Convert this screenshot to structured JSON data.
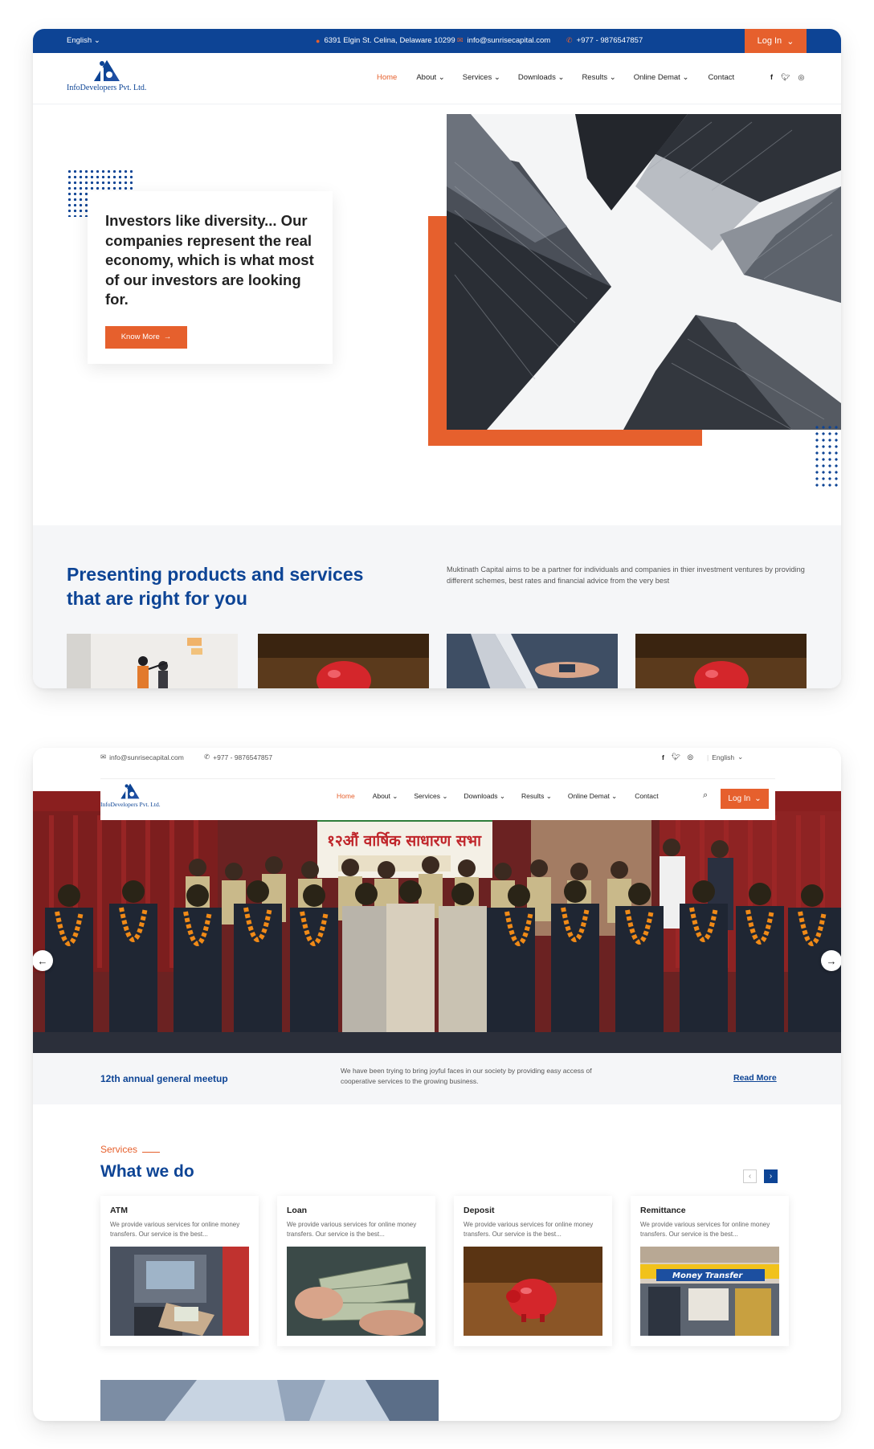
{
  "screen1": {
    "topbar": {
      "language": "English",
      "address": "6391 Elgin St. Celina, Delaware 10299",
      "email": "info@sunrisecapital.com",
      "phone": "+977 - 9876547857",
      "login": "Log In"
    },
    "logo_text": "InfoDevelopers Pvt. Ltd.",
    "nav": [
      "Home",
      "About",
      "Services",
      "Downloads",
      "Results",
      "Online Demat",
      "Contact"
    ],
    "socials": [
      "f",
      "t",
      "ig"
    ],
    "hero": {
      "quote": "Investors like diversity... Our companies represent the real economy, which is what most of our investors are looking for.",
      "button": "Know More"
    },
    "products": {
      "heading": "Presenting products and services that are right for you",
      "description": "Muktinath Capital aims to be a partner for individuals and companies in thier investment ventures by providing different schemes, best rates and financial advice from the very best"
    }
  },
  "screen2": {
    "topbar": {
      "email": "info@sunrisecapital.com",
      "phone": "+977 - 9876547857",
      "language": "English"
    },
    "logo_text": "InfoDevelopers Pvt. Ltd.",
    "nav": [
      "Home",
      "About",
      "Services",
      "Downloads",
      "Results",
      "Online Demat",
      "Contact"
    ],
    "login": "Log In",
    "banner": {
      "sign_text": "१२औं वार्षिक साधारण सभा"
    },
    "meetup": {
      "title": "12th annual general meetup",
      "description": "We have been trying to bring joyful faces in our society by providing easy access of cooperative services to the growing business.",
      "link": "Read More"
    },
    "services": {
      "kicker": "Services",
      "title": "What we do",
      "cards": [
        {
          "title": "ATM",
          "desc": "We provide various services for online money transfers. Our service is the best..."
        },
        {
          "title": "Loan",
          "desc": "We provide various services for online money transfers. Our service is the best..."
        },
        {
          "title": "Deposit",
          "desc": "We provide various services for online money transfers. Our service is the best..."
        },
        {
          "title": "Remittance",
          "desc": "We provide various services for online money transfers. Our service is the best..."
        }
      ],
      "remittance_sign": "Money Transfer"
    }
  },
  "colors": {
    "brand_blue": "#0d4495",
    "accent_orange": "#e6602d",
    "light_bg": "#f5f6f8"
  }
}
